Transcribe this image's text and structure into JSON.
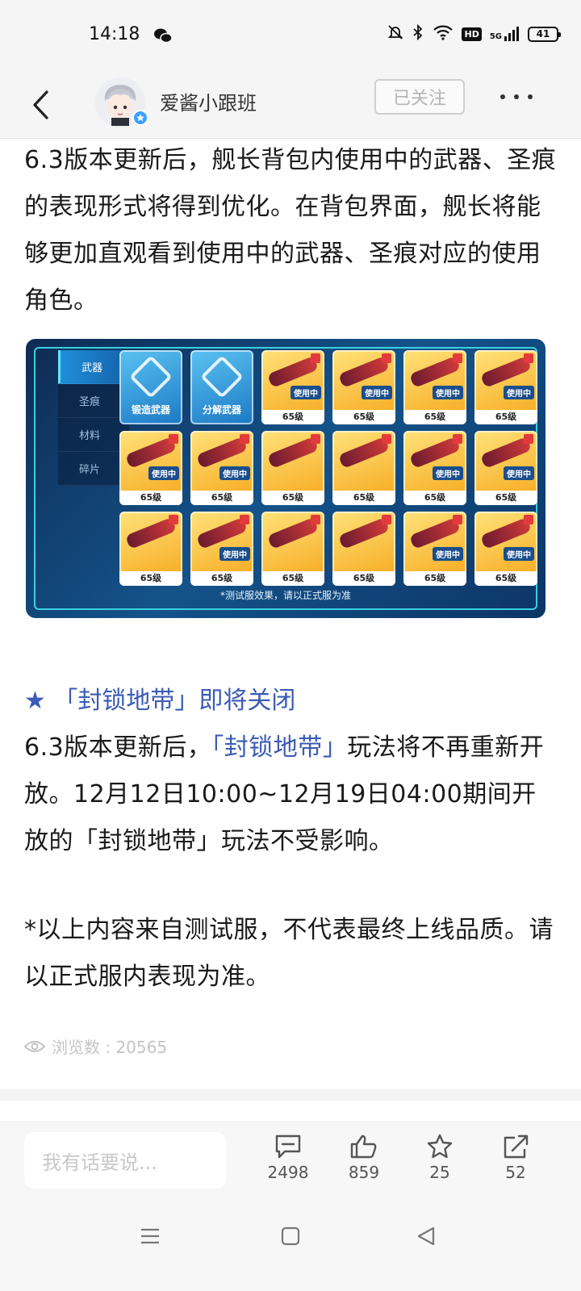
{
  "status_bar": {
    "time": "14:18",
    "network": "5G",
    "hd": "HD",
    "battery": "41"
  },
  "header": {
    "author": "爱酱小跟班",
    "follow_label": "已关注"
  },
  "article": {
    "paragraph1": "6.3版本更新后，舰长背包内使用中的武器、圣痕的表现形式将得到优化。在背包界面，舰长将能够更加直观看到使用中的武器、圣痕对应的使用角色。",
    "screenshot": {
      "tabs": [
        "武器",
        "圣痕",
        "材料",
        "碎片"
      ],
      "action_tiles": [
        "锻造武器",
        "分解武器"
      ],
      "in_use_label": "使用中",
      "level_label": "65级",
      "note": "*测试服效果，请以正式服为准"
    },
    "section_title": "★ 「封锁地带」即将关闭",
    "paragraph2_prefix": "6.3版本更新后，",
    "paragraph2_highlight": "「封锁地带」",
    "paragraph2_suffix": "玩法将不再重新开放。12月12日10:00~12月19日04:00期间开放的「封锁地带」玩法不受影响。",
    "paragraph3": "*以上内容来自测试服，不代表最终上线品质。请以正式服内表现为准。",
    "views_label": "浏览数 : 20565"
  },
  "bottom_bar": {
    "comment_placeholder": "我有话要说...",
    "comments_count": "2498",
    "likes_count": "859",
    "favorites_count": "25",
    "shares_count": "52"
  },
  "colors": {
    "accent_blue": "#3b5bb5",
    "background": "#ffffff",
    "header_bg": "#f5f5f5"
  }
}
